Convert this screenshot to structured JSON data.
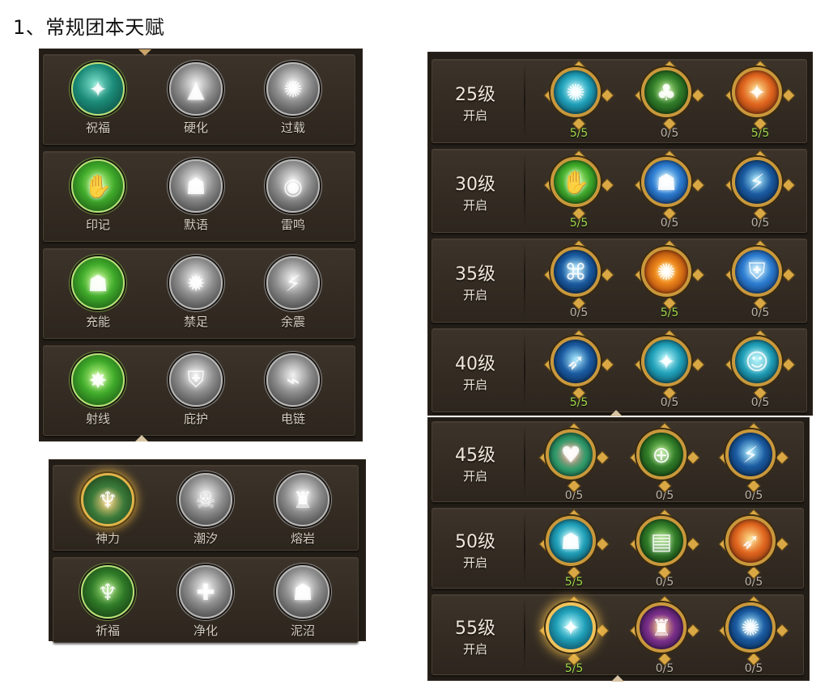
{
  "title": "1、常规团本天赋",
  "left_panel": {
    "rows": [
      [
        {
          "name": "祝福",
          "icon": "blessing-icon",
          "theme": "bg-teal",
          "ring": "green-ring",
          "glyph": "✦"
        },
        {
          "name": "硬化",
          "icon": "harden-icon",
          "theme": "bg-silver",
          "ring": "gray",
          "glyph": "▲"
        },
        {
          "name": "过载",
          "icon": "overload-icon",
          "theme": "bg-silver",
          "ring": "gray",
          "glyph": "✺"
        }
      ],
      [
        {
          "name": "印记",
          "icon": "mark-icon",
          "theme": "bg-green",
          "ring": "green-ring",
          "glyph": "✋"
        },
        {
          "name": "默语",
          "icon": "silence-icon",
          "theme": "bg-silver",
          "ring": "gray",
          "glyph": "☗"
        },
        {
          "name": "雷鸣",
          "icon": "thunder-icon",
          "theme": "bg-silver",
          "ring": "gray",
          "glyph": "◉"
        }
      ],
      [
        {
          "name": "充能",
          "icon": "charge-icon",
          "theme": "bg-green",
          "ring": "green-ring",
          "glyph": "☗"
        },
        {
          "name": "禁足",
          "icon": "bind-icon",
          "theme": "bg-silver",
          "ring": "gray",
          "glyph": "✹"
        },
        {
          "name": "余震",
          "icon": "aftershock-icon",
          "theme": "bg-silver",
          "ring": "gray",
          "glyph": "⚡"
        }
      ],
      [
        {
          "name": "射线",
          "icon": "ray-icon",
          "theme": "bg-green",
          "ring": "green-ring",
          "glyph": "✸"
        },
        {
          "name": "庇护",
          "icon": "shelter-icon",
          "theme": "bg-silver",
          "ring": "gray",
          "glyph": "⛨"
        },
        {
          "name": "电链",
          "icon": "chain-lightning-icon",
          "theme": "bg-silver",
          "ring": "gray",
          "glyph": "⌁"
        }
      ]
    ]
  },
  "bottom_left_panel": {
    "rows": [
      [
        {
          "name": "神力",
          "icon": "divine-power-icon",
          "theme": "bg-gold",
          "ring": "gold-ring",
          "glyph": "♆"
        },
        {
          "name": "潮汐",
          "icon": "tide-icon",
          "theme": "bg-silver",
          "ring": "gray",
          "glyph": "☠"
        },
        {
          "name": "熔岩",
          "icon": "lava-icon",
          "theme": "bg-silver",
          "ring": "gray",
          "glyph": "♜"
        }
      ],
      [
        {
          "name": "祈福",
          "icon": "pray-icon",
          "theme": "bg-darkgreen",
          "ring": "green-ring",
          "glyph": "♆"
        },
        {
          "name": "净化",
          "icon": "purify-icon",
          "theme": "bg-silver",
          "ring": "gray",
          "glyph": "✚"
        },
        {
          "name": "泥沼",
          "icon": "swamp-icon",
          "theme": "bg-silver",
          "ring": "gray",
          "glyph": "☗"
        }
      ]
    ]
  },
  "right_panel_top": {
    "rows": [
      {
        "level": "25级",
        "open": "开启",
        "skills": [
          {
            "icon": "spirit-wolf-icon",
            "theme": "bg-cyan",
            "count": "5/5",
            "full": true,
            "glyph": "✺"
          },
          {
            "icon": "treant-icon",
            "theme": "bg-darkgreen",
            "count": "0/5",
            "full": false,
            "glyph": "♣"
          },
          {
            "icon": "fire-orb-icon",
            "theme": "bg-orange",
            "count": "5/5",
            "full": true,
            "glyph": "✦"
          }
        ]
      },
      {
        "level": "30级",
        "open": "开启",
        "skills": [
          {
            "icon": "nature-hand-icon",
            "theme": "bg-green",
            "count": "5/5",
            "full": true,
            "glyph": "✋"
          },
          {
            "icon": "earth-giant-icon",
            "theme": "bg-blue",
            "count": "0/5",
            "full": false,
            "glyph": "☗"
          },
          {
            "icon": "storm-strike-icon",
            "theme": "bg-deep",
            "count": "0/5",
            "full": false,
            "glyph": "⚡"
          }
        ]
      },
      {
        "level": "35级",
        "open": "开启",
        "skills": [
          {
            "icon": "rune-icon",
            "theme": "bg-deep",
            "count": "0/5",
            "full": false,
            "glyph": "⌘"
          },
          {
            "icon": "sun-burst-icon",
            "theme": "bg-fire",
            "count": "5/5",
            "full": true,
            "glyph": "✺"
          },
          {
            "icon": "crystal-shield-icon",
            "theme": "bg-blue",
            "count": "0/5",
            "full": false,
            "glyph": "⛨"
          }
        ]
      },
      {
        "level": "40级",
        "open": "开启",
        "skills": [
          {
            "icon": "ice-spear-icon",
            "theme": "bg-deep",
            "count": "5/5",
            "full": true,
            "glyph": "➶"
          },
          {
            "icon": "water-staff-icon",
            "theme": "bg-cyan",
            "count": "0/5",
            "full": false,
            "glyph": "✦"
          },
          {
            "icon": "water-spirit-icon",
            "theme": "bg-cyan",
            "count": "0/5",
            "full": false,
            "glyph": "☺"
          }
        ]
      }
    ]
  },
  "right_panel_bottom": {
    "rows": [
      {
        "level": "45级",
        "open": "开启",
        "skills": [
          {
            "icon": "healing-heart-icon",
            "theme": "bg-heart",
            "count": "0/5",
            "full": false,
            "glyph": "♥"
          },
          {
            "icon": "crosshair-icon",
            "theme": "bg-darkgreen",
            "count": "0/5",
            "full": false,
            "glyph": "⊕"
          },
          {
            "icon": "lightning-hit-icon",
            "theme": "bg-deep",
            "count": "0/5",
            "full": false,
            "glyph": "⚡"
          }
        ]
      },
      {
        "level": "50级",
        "open": "开启",
        "skills": [
          {
            "icon": "hooded-spirit-icon",
            "theme": "bg-cyan",
            "count": "5/5",
            "full": true,
            "glyph": "☗"
          },
          {
            "icon": "tome-icon",
            "theme": "bg-darkgreen",
            "count": "0/5",
            "full": false,
            "glyph": "▤"
          },
          {
            "icon": "flame-slash-icon",
            "theme": "bg-orange",
            "count": "0/5",
            "full": false,
            "glyph": "➶"
          }
        ]
      },
      {
        "level": "55级",
        "open": "开启",
        "skills": [
          {
            "icon": "totem-staff-icon",
            "theme": "bg-cyan",
            "count": "5/5",
            "full": true,
            "glyph": "✦",
            "glow": true
          },
          {
            "icon": "fire-totem-icon",
            "theme": "bg-purple",
            "count": "0/5",
            "full": false,
            "glyph": "♜"
          },
          {
            "icon": "thunder-burst-icon",
            "theme": "bg-deep",
            "count": "0/5",
            "full": false,
            "glyph": "✺"
          }
        ]
      }
    ]
  }
}
